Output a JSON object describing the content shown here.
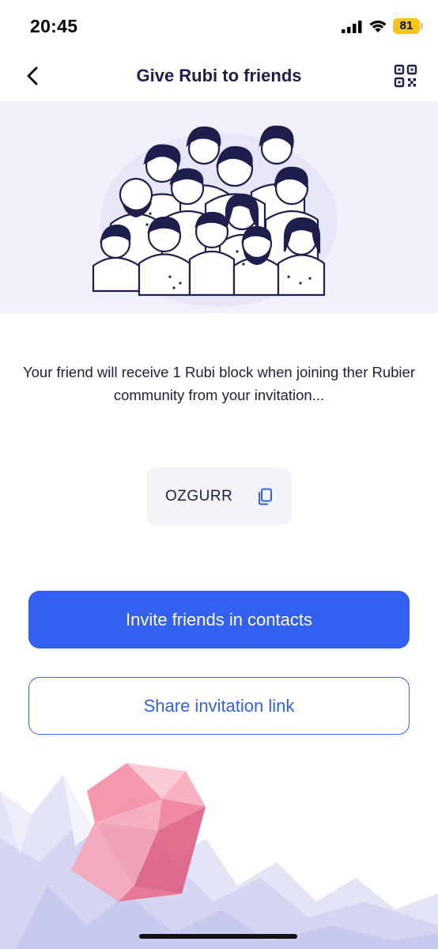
{
  "status_bar": {
    "time": "20:45",
    "battery_level": "81",
    "icons": [
      "signal-icon",
      "wifi-icon",
      "battery-icon"
    ]
  },
  "header": {
    "title": "Give Rubi to friends",
    "back_icon": "chevron-left-icon",
    "qr_icon": "qr-code-icon"
  },
  "hero": {
    "illustration": "group-of-people-illustration"
  },
  "main": {
    "description": "Your friend will receive 1 Rubi block when joining ther Rubier community from your invitation...",
    "invite_code": "OZGURR",
    "copy_icon": "copy-icon"
  },
  "actions": {
    "invite_contacts_label": "Invite friends in contacts",
    "share_link_label": "Share invitation link"
  },
  "colors": {
    "accent": "#3360f0",
    "title": "#1f1f4e",
    "hero_bg": "#f1f1fb",
    "code_bg": "#f2f4f9",
    "battery": "#f5c518"
  },
  "decor": {
    "bottom_art": "ruby-gem-low-poly-art"
  }
}
